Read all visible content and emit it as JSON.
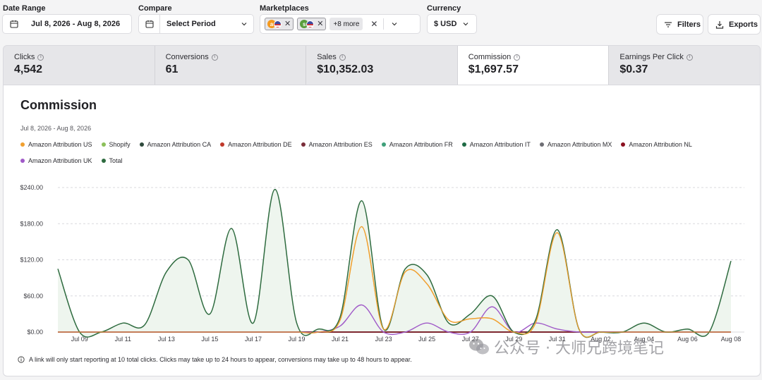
{
  "filters": {
    "date_range": {
      "label": "Date Range",
      "value": "Jul 8, 2026 - Aug 8, 2026",
      "icon": "calendar-icon"
    },
    "compare": {
      "label": "Compare",
      "value": "Select Period",
      "icon": "calendar-icon"
    },
    "marketplaces": {
      "label": "Marketplaces",
      "chips": [
        {
          "logo": "a",
          "flag": "us"
        },
        {
          "logo": "s",
          "flag": "us"
        }
      ],
      "more": "+8 more"
    },
    "currency": {
      "label": "Currency",
      "value": "$ USD"
    }
  },
  "actions": {
    "filters_label": "Filters",
    "exports_label": "Exports"
  },
  "metrics": [
    {
      "label": "Clicks",
      "value": "4,542",
      "active": false
    },
    {
      "label": "Conversions",
      "value": "61",
      "active": false
    },
    {
      "label": "Sales",
      "value": "$10,352.03",
      "active": false
    },
    {
      "label": "Commission",
      "value": "$1,697.57",
      "active": true
    },
    {
      "label": "Earnings Per Click",
      "value": "$0.37",
      "active": false
    }
  ],
  "colors": {
    "accent": "#2e6b3f",
    "total_fill": "#eef5ee",
    "grid": "#d9d9de"
  },
  "chart_data": {
    "type": "line",
    "title": "Commission",
    "subtitle": "Jul 8, 2026 - Aug 8, 2026",
    "x": [
      "Jul 08",
      "Jul 09",
      "Jul 10",
      "Jul 11",
      "Jul 12",
      "Jul 13",
      "Jul 14",
      "Jul 15",
      "Jul 16",
      "Jul 17",
      "Jul 18",
      "Jul 19",
      "Jul 20",
      "Jul 21",
      "Jul 22",
      "Jul 23",
      "Jul 24",
      "Jul 25",
      "Jul 26",
      "Jul 27",
      "Jul 28",
      "Jul 29",
      "Jul 30",
      "Jul 31",
      "Aug 01",
      "Aug 02",
      "Aug 03",
      "Aug 04",
      "Aug 05",
      "Aug 06",
      "Aug 07",
      "Aug 08"
    ],
    "x_tick_labels": [
      "Jul 09",
      "Jul 11",
      "Jul 13",
      "Jul 15",
      "Jul 17",
      "Jul 19",
      "Jul 21",
      "Jul 23",
      "Jul 25",
      "Jul 27",
      "Jul 29",
      "Jul 31",
      "Aug 02",
      "Aug 04",
      "Aug 06",
      "Aug 08"
    ],
    "y_ticks": [
      "$0.00",
      "$60.00",
      "$120.00",
      "$180.00",
      "$240.00"
    ],
    "ylim": [
      0,
      240
    ],
    "grid": true,
    "legend_position": "top",
    "series": [
      {
        "name": "Amazon Attribution US",
        "color": "#f0a030",
        "values": [
          0,
          0,
          0,
          0,
          0,
          0,
          0,
          0,
          0,
          0,
          0,
          0,
          0,
          20,
          175,
          5,
          100,
          80,
          20,
          22,
          22,
          0,
          15,
          165,
          5,
          0,
          0,
          0,
          0,
          0,
          0,
          0
        ]
      },
      {
        "name": "Shopify",
        "color": "#8cc05a",
        "values": [
          0,
          0,
          0,
          0,
          0,
          0,
          0,
          0,
          0,
          0,
          0,
          0,
          0,
          0,
          0,
          0,
          0,
          0,
          0,
          0,
          0,
          0,
          0,
          0,
          0,
          0,
          0,
          0,
          0,
          0,
          0,
          0
        ]
      },
      {
        "name": "Amazon Attribution CA",
        "color": "#2f4a3c",
        "values": [
          0,
          0,
          0,
          0,
          0,
          0,
          0,
          0,
          0,
          0,
          0,
          0,
          0,
          0,
          0,
          0,
          0,
          0,
          0,
          0,
          0,
          0,
          0,
          0,
          0,
          0,
          0,
          0,
          0,
          0,
          0,
          0
        ]
      },
      {
        "name": "Amazon Attribution DE",
        "color": "#c0392b",
        "values": [
          0,
          0,
          0,
          0,
          0,
          0,
          0,
          0,
          0,
          0,
          0,
          0,
          0,
          0,
          0,
          0,
          0,
          0,
          0,
          0,
          0,
          0,
          0,
          0,
          0,
          0,
          0,
          0,
          0,
          0,
          0,
          0
        ]
      },
      {
        "name": "Amazon Attribution ES",
        "color": "#7a2e3a",
        "values": [
          0,
          0,
          0,
          0,
          0,
          0,
          0,
          0,
          0,
          0,
          0,
          0,
          0,
          0,
          0,
          0,
          0,
          0,
          0,
          0,
          0,
          0,
          0,
          0,
          0,
          0,
          0,
          0,
          0,
          0,
          0,
          0
        ]
      },
      {
        "name": "Amazon Attribution FR",
        "color": "#3fa07a",
        "values": [
          0,
          0,
          0,
          0,
          0,
          0,
          0,
          0,
          0,
          0,
          0,
          0,
          0,
          0,
          0,
          0,
          0,
          0,
          0,
          0,
          0,
          0,
          0,
          0,
          0,
          0,
          0,
          0,
          0,
          0,
          0,
          0
        ]
      },
      {
        "name": "Amazon Attribution IT",
        "color": "#1f6b45",
        "values": [
          0,
          0,
          0,
          0,
          0,
          0,
          0,
          0,
          0,
          0,
          0,
          0,
          0,
          0,
          0,
          0,
          0,
          0,
          0,
          0,
          0,
          0,
          0,
          0,
          0,
          0,
          0,
          0,
          0,
          0,
          0,
          0
        ]
      },
      {
        "name": "Amazon Attribution MX",
        "color": "#6e6e74",
        "values": [
          0,
          0,
          0,
          0,
          0,
          0,
          0,
          0,
          0,
          0,
          0,
          0,
          0,
          0,
          0,
          0,
          0,
          0,
          0,
          0,
          0,
          0,
          0,
          0,
          0,
          0,
          0,
          0,
          0,
          0,
          0,
          0
        ]
      },
      {
        "name": "Amazon Attribution NL",
        "color": "#8b1020",
        "values": [
          0,
          0,
          0,
          0,
          0,
          0,
          0,
          0,
          0,
          0,
          0,
          0,
          0,
          0,
          0,
          0,
          0,
          0,
          0,
          0,
          0,
          0,
          0,
          0,
          0,
          0,
          0,
          0,
          0,
          0,
          0,
          0
        ]
      },
      {
        "name": "Amazon Attribution UK",
        "color": "#a05ac8",
        "values": [
          0,
          0,
          0,
          0,
          0,
          0,
          0,
          0,
          0,
          0,
          0,
          0,
          0,
          0,
          0,
          0,
          0,
          0,
          0,
          0,
          0,
          0,
          0,
          0,
          0,
          0,
          0,
          0,
          0,
          0,
          0,
          0
        ],
        "overlay": [
          0,
          0,
          0,
          0,
          0,
          0,
          0,
          0,
          0,
          0,
          0,
          0,
          0,
          10,
          45,
          0,
          0,
          15,
          0,
          0,
          42,
          0,
          15,
          5,
          0,
          0,
          0,
          0,
          0,
          0,
          0,
          0
        ]
      },
      {
        "name": "Total",
        "color": "#2e6b3f",
        "values": [
          105,
          0,
          0,
          15,
          12,
          100,
          120,
          30,
          172,
          15,
          237,
          15,
          5,
          25,
          218,
          5,
          105,
          95,
          15,
          30,
          60,
          0,
          20,
          170,
          5,
          0,
          0,
          15,
          0,
          5,
          0,
          118
        ]
      }
    ]
  },
  "footnote": "A link will only start reporting at 10 total clicks. Clicks may take up to 24 hours to appear, conversions may take up to 48 hours to appear.",
  "watermark": "公众号 · 大师兄跨境笔记"
}
